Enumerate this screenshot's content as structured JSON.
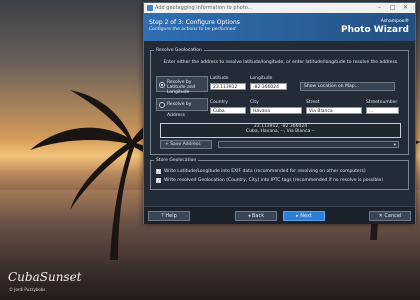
{
  "window": {
    "title": "Add geotagging information to photo...",
    "step_title": "Step 2 of 3: Configure Options",
    "step_subtitle": "Configure the actions to be performed.",
    "brand": "Ashampoo®",
    "product": "Photo Wizard"
  },
  "resolve": {
    "legend": "Resolve Geolocation",
    "instructions": "Enter either the address to resolve latitude/longitude, or enter latitude/longitude to resolve the address.",
    "option_latlong": "Resolve by Latitude and Longitude",
    "option_address": "Resolve by Address",
    "selected": "latlong",
    "latitude_label": "Latitude",
    "latitude_value": "23.113912",
    "longitude_label": "Longitude",
    "longitude_value": "-82.366024",
    "show_map_button": "Show Location on Map...",
    "country_label": "Country",
    "country_value": "Cuba",
    "city_label": "City",
    "city_value": "Havana",
    "street_label": "Street",
    "street_value": "Via Blanca",
    "streetnumber_label": "Streetnumber",
    "streetnumber_value": "...",
    "result_line1": "23.113912, -82.366024",
    "result_line2": "Cuba, Havana, --, Via Blanca --",
    "save_address_button": "Save Address"
  },
  "store": {
    "legend": "Store Geolocation",
    "write_exif": "Write Latitude/Longitude into EXIF data (recommended for resolving on other computers)",
    "write_iptc": "Write resolved Geolocation (Country, City) into IPTC tags (recommended if no resolve is possible)",
    "write_exif_checked": true,
    "write_iptc_checked": true
  },
  "footer": {
    "help": "Help",
    "back": "Back",
    "next": "Next",
    "cancel": "Cancel"
  },
  "photo": {
    "caption": "CubaSunset",
    "copyright": "© Jordi Puzzybobs"
  },
  "colors": {
    "header_blue": "#2f6fb3",
    "primary_button": "#2d7fd3",
    "dialog_bg": "#222b36"
  }
}
